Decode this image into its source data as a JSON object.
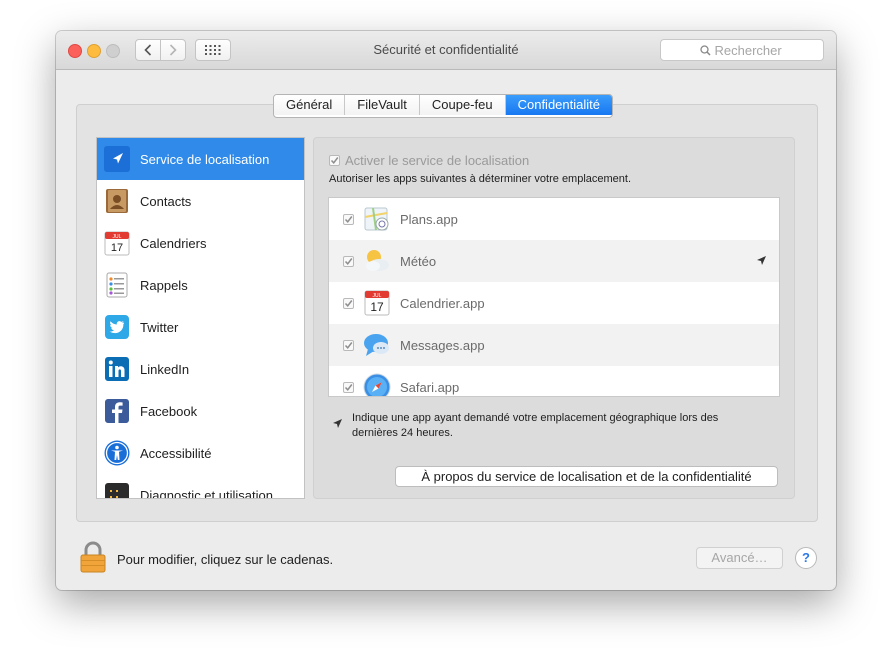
{
  "window": {
    "title": "Sécurité et confidentialité",
    "search_placeholder": "Rechercher"
  },
  "tabs": [
    {
      "label": "Général",
      "active": false
    },
    {
      "label": "FileVault",
      "active": false
    },
    {
      "label": "Coupe-feu",
      "active": false
    },
    {
      "label": "Confidentialité",
      "active": true
    }
  ],
  "sidebar": {
    "items": [
      {
        "label": "Service de localisation",
        "icon": "location-arrow-icon",
        "selected": true
      },
      {
        "label": "Contacts",
        "icon": "contacts-icon",
        "selected": false
      },
      {
        "label": "Calendriers",
        "icon": "calendar-icon",
        "selected": false
      },
      {
        "label": "Rappels",
        "icon": "reminders-icon",
        "selected": false
      },
      {
        "label": "Twitter",
        "icon": "twitter-icon",
        "selected": false
      },
      {
        "label": "LinkedIn",
        "icon": "linkedin-icon",
        "selected": false
      },
      {
        "label": "Facebook",
        "icon": "facebook-icon",
        "selected": false
      },
      {
        "label": "Accessibilité",
        "icon": "accessibility-icon",
        "selected": false
      },
      {
        "label": "Diagnostic et utilisation",
        "icon": "diagnostics-icon",
        "selected": false
      }
    ]
  },
  "location": {
    "enable_label": "Activer le service de localisation",
    "enable_checked": true,
    "description": "Autoriser les apps suivantes à déterminer votre emplacement.",
    "apps": [
      {
        "name": "Plans.app",
        "icon": "maps-icon",
        "checked": true,
        "recent": false
      },
      {
        "name": "Météo",
        "icon": "weather-icon",
        "checked": true,
        "recent": true
      },
      {
        "name": "Calendrier.app",
        "icon": "calendar-icon",
        "checked": true,
        "recent": false
      },
      {
        "name": "Messages.app",
        "icon": "messages-icon",
        "checked": true,
        "recent": false
      },
      {
        "name": "Safari.app",
        "icon": "safari-icon",
        "checked": true,
        "recent": false
      }
    ],
    "note": "Indique une app ayant demandé votre emplacement géographique lors des dernières 24 heures.",
    "about_button": "À propos du service de localisation et de la confidentialité",
    "calendar_month": "JUL",
    "calendar_day": "17"
  },
  "footer": {
    "lock_text": "Pour modifier, cliquez sur le cadenas.",
    "advanced_button": "Avancé…",
    "help_label": "?"
  },
  "colors": {
    "accent": "#2f8ae9",
    "tab_active": "#1877f2",
    "disabled_text": "#9a9a9a"
  }
}
